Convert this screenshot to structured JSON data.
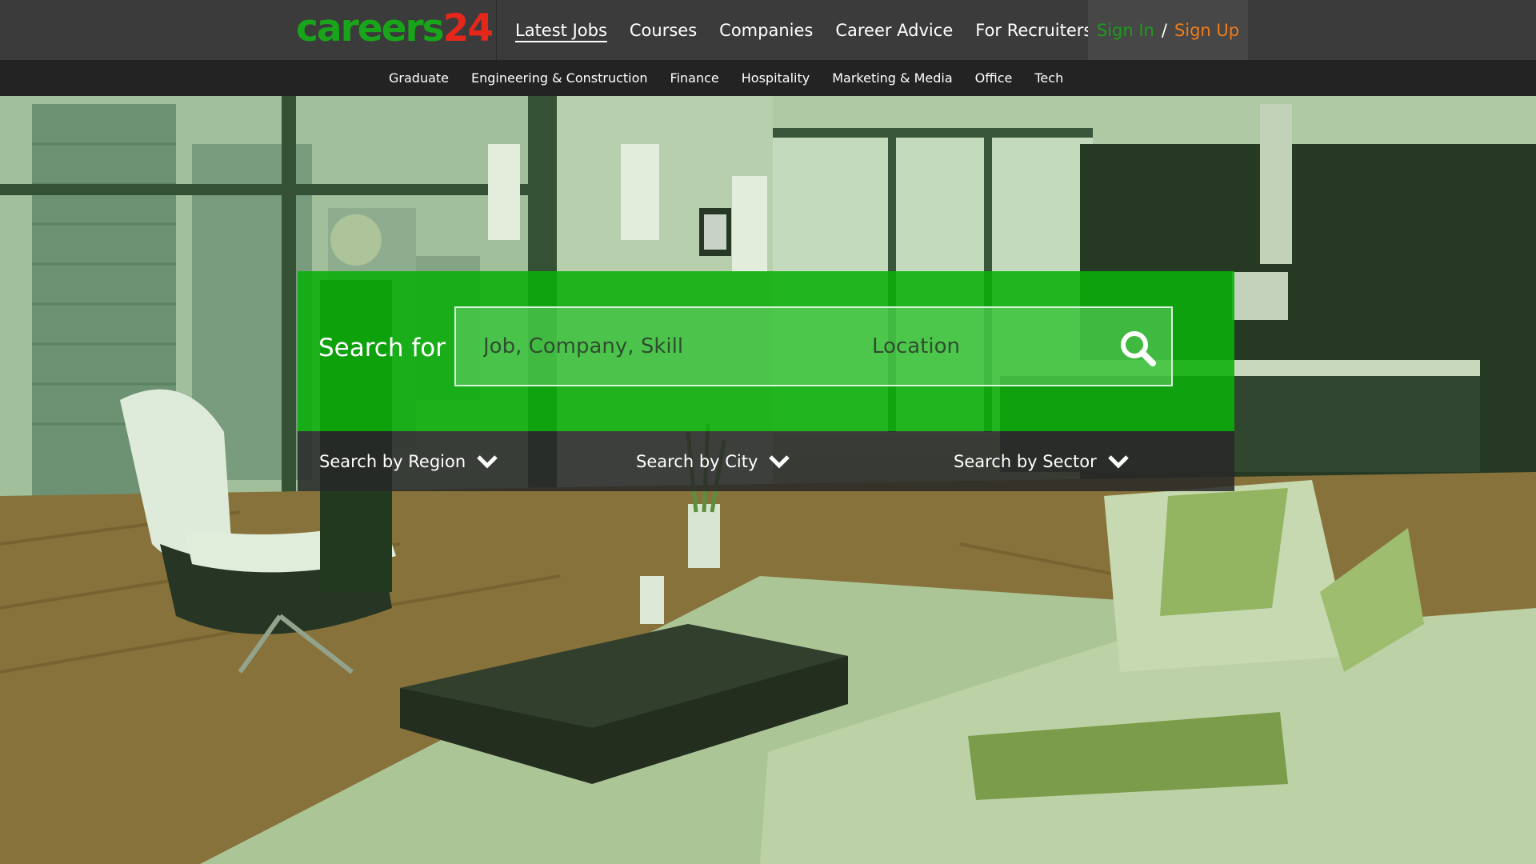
{
  "brand": {
    "logo_part1": "careers",
    "logo_part2": "24"
  },
  "main_nav": [
    {
      "label": "Latest Jobs",
      "active": true
    },
    {
      "label": "Courses",
      "active": false
    },
    {
      "label": "Companies",
      "active": false
    },
    {
      "label": "Career Advice",
      "active": false
    },
    {
      "label": "For Recruiters",
      "active": false
    }
  ],
  "auth": {
    "sign_in": "Sign In",
    "separator": "/",
    "sign_up": "Sign Up"
  },
  "sector_nav": [
    "Graduate",
    "Engineering & Construction",
    "Finance",
    "Hospitality",
    "Marketing & Media",
    "Office",
    "Tech"
  ],
  "search": {
    "label": "Search for",
    "query_placeholder": "Job, Company, Skill",
    "location_placeholder": "Location",
    "button_icon": "search-icon"
  },
  "filters": [
    {
      "label": "Search by Region",
      "icon": "chevron-down-icon"
    },
    {
      "label": "Search by City",
      "icon": "chevron-down-icon"
    },
    {
      "label": "Search by Sector",
      "icon": "chevron-down-icon"
    }
  ],
  "colors": {
    "brand_green": "#19a51a",
    "brand_red": "#e5261a",
    "sign_up_orange": "#f07b19",
    "panel_green": "#0aaf0a",
    "header_dark": "#3b3b3b",
    "subnav_dark": "#232323"
  }
}
